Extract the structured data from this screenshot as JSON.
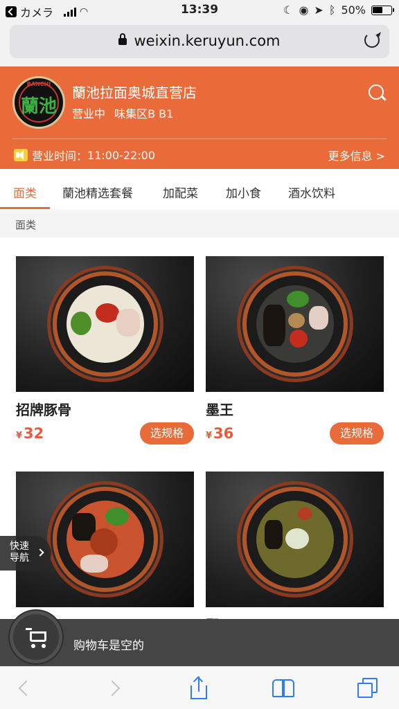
{
  "status_bar": {
    "carrier": "カメラ",
    "time": "13:39",
    "battery": "50%"
  },
  "address_bar": {
    "url": "weixin.keruyun.com"
  },
  "store": {
    "logo_text": "蘭池",
    "name": "蘭池拉面奥城直营店",
    "status": "营业中",
    "location": "味集区B B1",
    "hours_label": "营业时间：",
    "hours": "11:00-22:00",
    "more_info": "更多信息 >"
  },
  "tabs": [
    {
      "label": "面类",
      "active": true
    },
    {
      "label": "蘭池精选套餐",
      "active": false
    },
    {
      "label": "加配菜",
      "active": false
    },
    {
      "label": "加小食",
      "active": false
    },
    {
      "label": "酒水饮料",
      "active": false
    }
  ],
  "section_title": "面类",
  "products": [
    {
      "name": "招牌豚骨",
      "currency": "¥",
      "price": "32",
      "button": "选规格"
    },
    {
      "name": "墨王",
      "currency": "¥",
      "price": "36",
      "button": "选规格"
    },
    {
      "name": "",
      "currency": "",
      "price": "",
      "button": ""
    },
    {
      "name": "翠玉",
      "currency": "",
      "price": "",
      "button": ""
    }
  ],
  "quick_nav": {
    "label": "快速导航"
  },
  "cart": {
    "text": "购物车是空的"
  },
  "colors": {
    "brand_orange": "#ea6b3a",
    "price_red": "#e85a3a",
    "cart_bar": "#454545",
    "ios_blue": "#2f7cf6"
  }
}
